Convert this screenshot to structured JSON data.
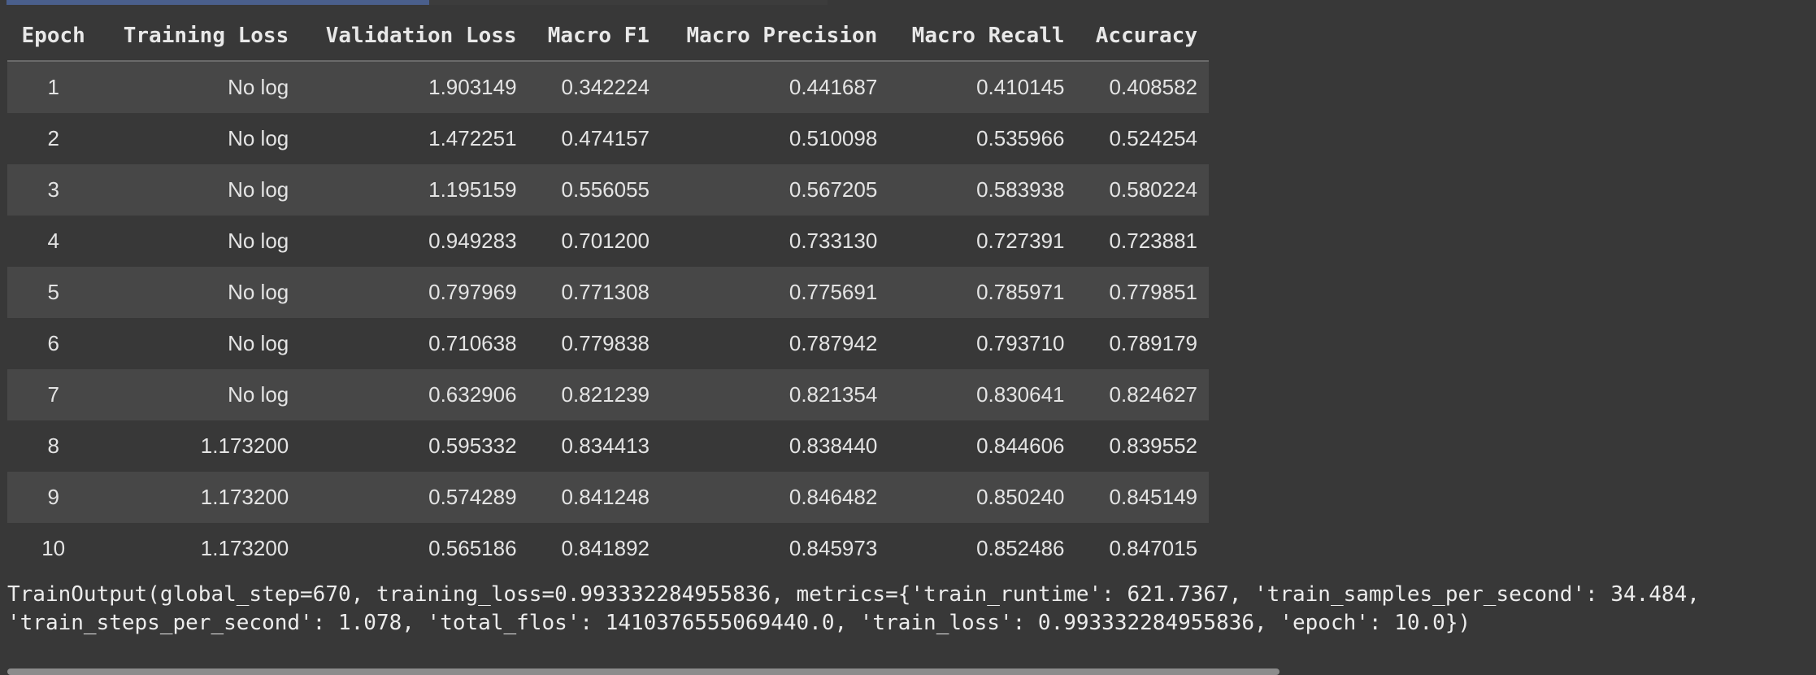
{
  "results_table": {
    "headers": [
      "Epoch",
      "Training Loss",
      "Validation Loss",
      "Macro F1",
      "Macro Precision",
      "Macro Recall",
      "Accuracy"
    ],
    "rows": [
      [
        "1",
        "No log",
        "1.903149",
        "0.342224",
        "0.441687",
        "0.410145",
        "0.408582"
      ],
      [
        "2",
        "No log",
        "1.472251",
        "0.474157",
        "0.510098",
        "0.535966",
        "0.524254"
      ],
      [
        "3",
        "No log",
        "1.195159",
        "0.556055",
        "0.567205",
        "0.583938",
        "0.580224"
      ],
      [
        "4",
        "No log",
        "0.949283",
        "0.701200",
        "0.733130",
        "0.727391",
        "0.723881"
      ],
      [
        "5",
        "No log",
        "0.797969",
        "0.771308",
        "0.775691",
        "0.785971",
        "0.779851"
      ],
      [
        "6",
        "No log",
        "0.710638",
        "0.779838",
        "0.787942",
        "0.793710",
        "0.789179"
      ],
      [
        "7",
        "No log",
        "0.632906",
        "0.821239",
        "0.821354",
        "0.830641",
        "0.824627"
      ],
      [
        "8",
        "1.173200",
        "0.595332",
        "0.834413",
        "0.838440",
        "0.844606",
        "0.839552"
      ],
      [
        "9",
        "1.173200",
        "0.574289",
        "0.841248",
        "0.846482",
        "0.850240",
        "0.845149"
      ],
      [
        "10",
        "1.173200",
        "0.565186",
        "0.841892",
        "0.845973",
        "0.852486",
        "0.847015"
      ]
    ]
  },
  "console_output": {
    "line1": "TrainOutput(global_step=670, training_loss=0.993332284955836, metrics={'train_runtime': 621.7367, 'train_samples_per_second': 34.484,",
    "line2": "'train_steps_per_second': 1.078, 'total_flos': 1410376555069440.0, 'train_loss': 0.993332284955836, 'epoch': 10.0})"
  },
  "colors": {
    "background": "#383838",
    "row_striped": "#474747",
    "progress_bar": "#4a5f8c"
  }
}
